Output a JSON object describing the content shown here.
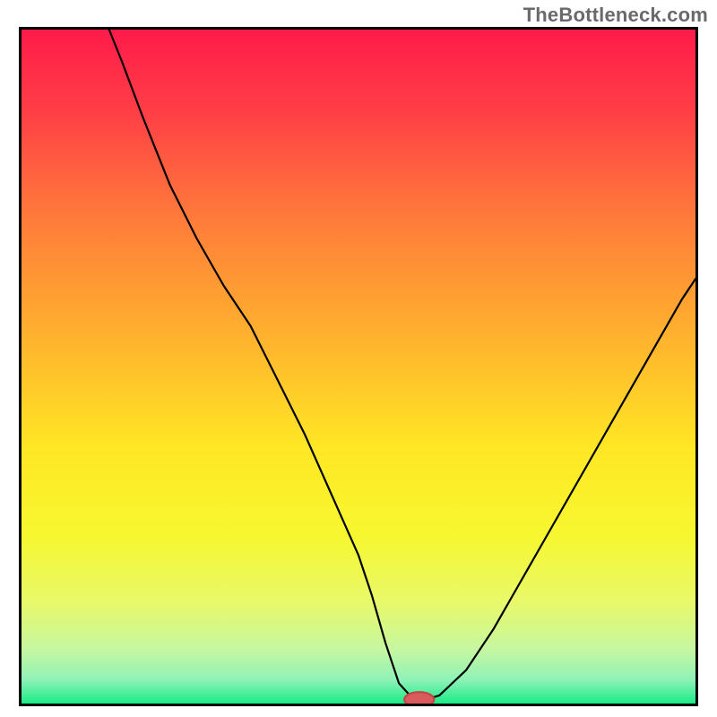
{
  "watermark": "TheBottleneck.com",
  "chart_data": {
    "type": "line",
    "title": "",
    "xlabel": "",
    "ylabel": "",
    "xlim": [
      0,
      100
    ],
    "ylim": [
      0,
      100
    ],
    "background_gradient_stops": [
      {
        "offset": 0.0,
        "color": "#ff1b4a"
      },
      {
        "offset": 0.12,
        "color": "#ff3e46"
      },
      {
        "offset": 0.28,
        "color": "#ff7b3a"
      },
      {
        "offset": 0.45,
        "color": "#ffb02e"
      },
      {
        "offset": 0.62,
        "color": "#ffe725"
      },
      {
        "offset": 0.75,
        "color": "#f7f72f"
      },
      {
        "offset": 0.85,
        "color": "#e8f96a"
      },
      {
        "offset": 0.92,
        "color": "#c6f7a1"
      },
      {
        "offset": 0.965,
        "color": "#8ef2b7"
      },
      {
        "offset": 1.0,
        "color": "#19ec85"
      }
    ],
    "series": [
      {
        "name": "bottleneck-curve",
        "color": "#000000",
        "stroke_width": 2.2,
        "x": [
          13.0,
          15.0,
          18.0,
          22.0,
          26.0,
          30.0,
          34.0,
          38.0,
          42.0,
          46.0,
          50.0,
          52.0,
          54.0,
          56.0,
          58.0,
          60.0,
          62.0,
          66.0,
          70.0,
          74.0,
          78.0,
          82.0,
          86.0,
          90.0,
          94.0,
          98.0,
          100.0
        ],
        "values": [
          100.0,
          95.0,
          87.0,
          77.0,
          69.0,
          62.0,
          56.0,
          48.0,
          40.0,
          31.0,
          22.0,
          16.0,
          9.0,
          3.0,
          0.8,
          0.6,
          1.2,
          5.0,
          11.0,
          18.0,
          25.0,
          32.0,
          39.0,
          46.0,
          53.0,
          60.0,
          63.0
        ]
      }
    ],
    "marker": {
      "name": "optimal-point",
      "x": 59.0,
      "y": 0.6,
      "rx": 2.2,
      "ry": 1.1,
      "fill": "#d95b5b",
      "stroke": "#c24747"
    }
  }
}
